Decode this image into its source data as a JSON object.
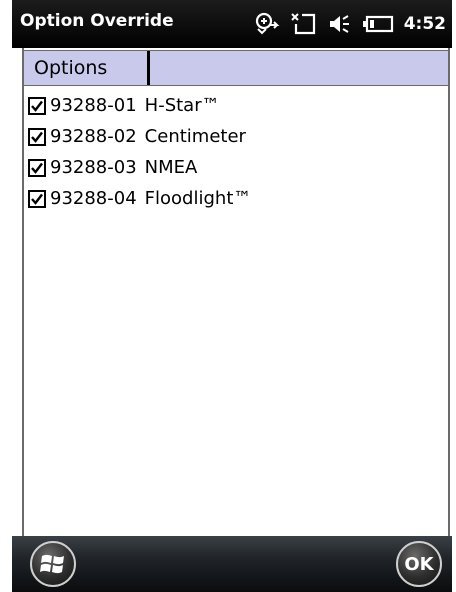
{
  "titlebar": {
    "title": "Option Override",
    "icons": [
      "network-sync-icon",
      "signal-off-icon",
      "speaker-icon",
      "battery-icon"
    ],
    "time": "4:52"
  },
  "list": {
    "columns": [
      "Options",
      ""
    ],
    "items": [
      {
        "code": "93288-01",
        "name": "H-Star™",
        "checked": true
      },
      {
        "code": "93288-02",
        "name": "Centimeter",
        "checked": true
      },
      {
        "code": "93288-03",
        "name": "NMEA",
        "checked": true
      },
      {
        "code": "93288-04",
        "name": "Floodlight™",
        "checked": true
      }
    ]
  },
  "bottombar": {
    "start_icon": "windows-logo-icon",
    "ok_label": "OK"
  },
  "colors": {
    "titlebar_bg": "#000000",
    "header_bg": "#c9c9ec",
    "frame_border": "#6a6a6a"
  }
}
